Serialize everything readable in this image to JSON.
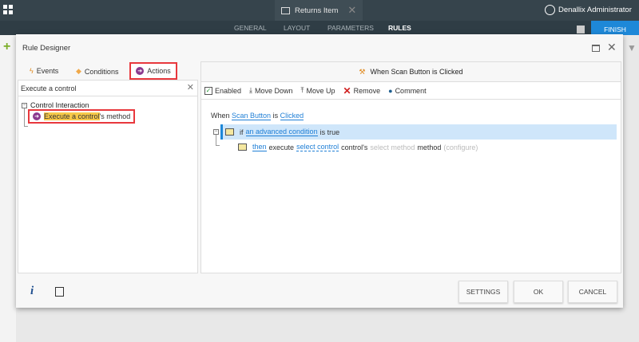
{
  "app": {
    "tab_title": "Returns Item",
    "user": "Denallix Administrator",
    "nav": [
      "GENERAL",
      "LAYOUT",
      "PARAMETERS",
      "RULES"
    ],
    "active_nav": "RULES",
    "finish": "FINISH"
  },
  "dialog": {
    "title": "Rule Designer",
    "tabs": [
      "Events",
      "Conditions",
      "Actions"
    ],
    "search_value": "Execute a control",
    "tree": {
      "group": "Control Interaction",
      "item_highlight": "Execute a control",
      "item_rest": "'s method"
    },
    "header": "When Scan Button is Clicked",
    "toolbar": [
      "Enabled",
      "Move Down",
      "Move Up",
      "Remove",
      "Comment"
    ],
    "rule": {
      "when": "When",
      "event_control": "Scan Button",
      "is": "is",
      "event": "Clicked",
      "if": "if",
      "condition": "an advanced condition",
      "is_true": "is true",
      "then": "then",
      "execute": "execute",
      "control": "select control",
      "controls": "control's",
      "method": "select method",
      "method_word": "method",
      "configure": "(configure)"
    },
    "footer": {
      "settings": "SETTINGS",
      "ok": "OK",
      "cancel": "CANCEL",
      "info": "i"
    }
  },
  "colors": {
    "accent": "#1e88d8",
    "highlight_box": "#e8383d",
    "actions_icon": "#8b3a8f"
  }
}
